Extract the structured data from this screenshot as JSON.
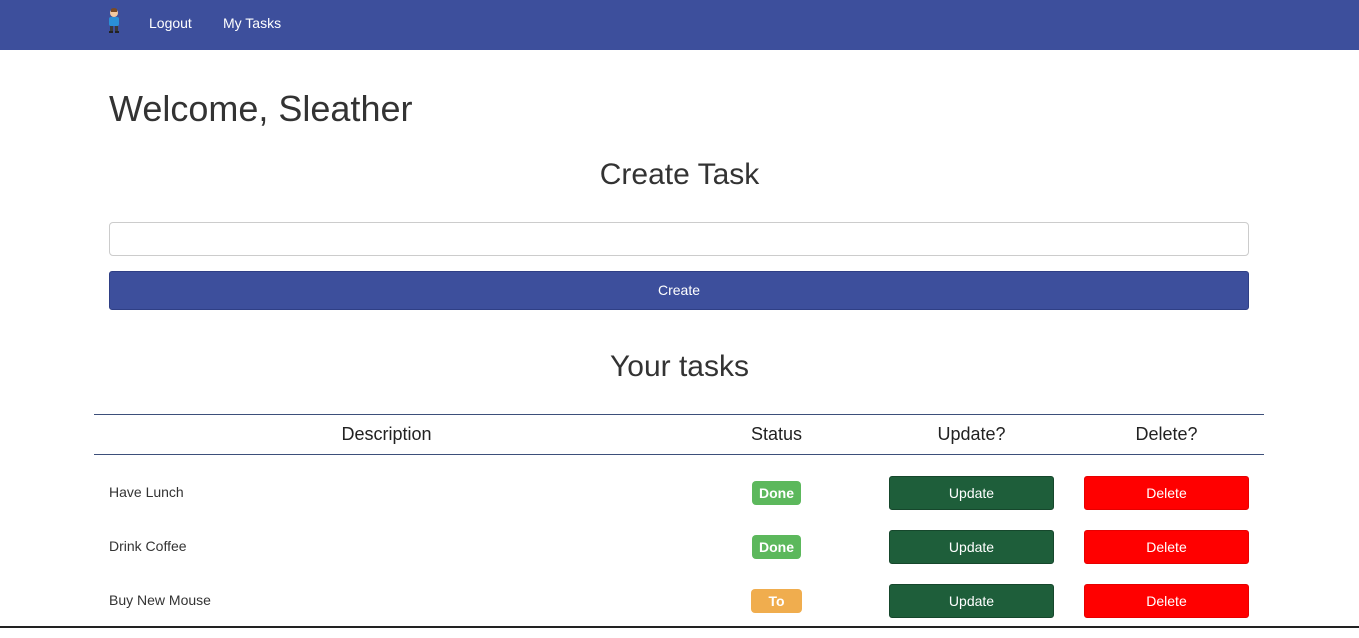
{
  "nav": {
    "logo_icon": "person-avatar-icon",
    "links": [
      "Logout",
      "My Tasks"
    ],
    "background": "#3d4f9c"
  },
  "welcome": "Welcome, Sleather",
  "create": {
    "title": "Create Task",
    "input_value": "",
    "input_placeholder": "",
    "button_label": "Create"
  },
  "tasks": {
    "title": "Your tasks",
    "columns": [
      "Description",
      "Status",
      "Update?",
      "Delete?"
    ],
    "rows": [
      {
        "description": "Have Lunch",
        "status": "Done",
        "update_label": "Update",
        "delete_label": "Delete"
      },
      {
        "description": "Drink Coffee",
        "status": "Done",
        "update_label": "Update",
        "delete_label": "Delete"
      },
      {
        "description": "Buy New Mouse",
        "status": "To do",
        "update_label": "Update",
        "delete_label": "Delete"
      }
    ]
  },
  "colors": {
    "done": "#5cb85c",
    "todo": "#f0ad4e",
    "update": "#1e5e3a",
    "delete": "#ff0000",
    "primary": "#3d4f9c"
  }
}
